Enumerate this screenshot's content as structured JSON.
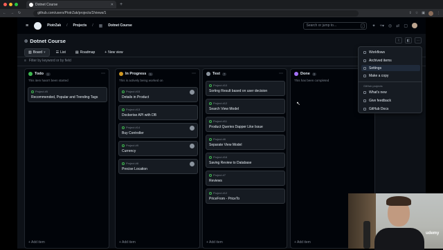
{
  "browser": {
    "tab_title": "Dotnet Course",
    "url": "github.com/users/PiotrZak/projects/2/views/1"
  },
  "header": {
    "breadcrumb_user": "PiotrZak",
    "breadcrumb_projects": "Projects",
    "breadcrumb_project": "Dotnet Course",
    "search_placeholder": "Search or jump to...",
    "search_kbd": "/"
  },
  "project": {
    "title": "Dotnet Course",
    "views": [
      {
        "label": "Board",
        "active": true
      },
      {
        "label": "List"
      },
      {
        "label": "Roadmap"
      },
      {
        "label": "New view"
      }
    ],
    "filter_placeholder": "Filter by keyword or by field"
  },
  "columns": [
    {
      "name": "Todo",
      "count": "1",
      "color": "#3fb950",
      "description": "This item hasn't been started",
      "cards": [
        {
          "meta": "Project #5",
          "title": "Recommended, Popular and Trending Tags",
          "avatar": false
        }
      ]
    },
    {
      "name": "In Progress",
      "count": "5",
      "color": "#d29922",
      "description": "This is actively being worked on",
      "cards": [
        {
          "meta": "Project #15",
          "title": "Details in Product",
          "avatar": true
        },
        {
          "meta": "Project #13",
          "title": "Dockerise API with DB",
          "avatar": false
        },
        {
          "meta": "Project #14",
          "title": "Buy Controller",
          "avatar": true
        },
        {
          "meta": "Project #9",
          "title": "Currency",
          "avatar": true
        },
        {
          "meta": "Project #8",
          "title": "Precise Location",
          "avatar": true
        }
      ]
    },
    {
      "name": "Test",
      "count": "7",
      "color": "#8b949e",
      "description": "",
      "cards": [
        {
          "meta": "Project #10",
          "title": "Sorting Result based on user decision",
          "avatar": false
        },
        {
          "meta": "Project #12",
          "title": "Search View Model",
          "avatar": false
        },
        {
          "meta": "Project #11",
          "title": "Product Queries Dapper Like Issue",
          "avatar": false
        },
        {
          "meta": "Project #6",
          "title": "Separate View Model",
          "avatar": false
        },
        {
          "meta": "Project #16",
          "title": "Saving Review to Database",
          "avatar": false
        },
        {
          "meta": "Project #7",
          "title": "Reviews",
          "avatar": false
        },
        {
          "meta": "Project #12",
          "title": "PriceFrom - PriceTo",
          "avatar": false
        }
      ]
    },
    {
      "name": "Done",
      "count": "0",
      "color": "#a371f7",
      "description": "This has been completed",
      "cards": []
    }
  ],
  "add_item_label": "Add item",
  "dropdown": {
    "items": [
      "Workflows",
      "Archived items",
      "Settings",
      "Make a copy"
    ],
    "selected": "Settings",
    "section_label": "GitHub projects",
    "section_items": [
      "What's new",
      "Give feedback",
      "GitHub Docs"
    ]
  },
  "watermark": "udemy"
}
